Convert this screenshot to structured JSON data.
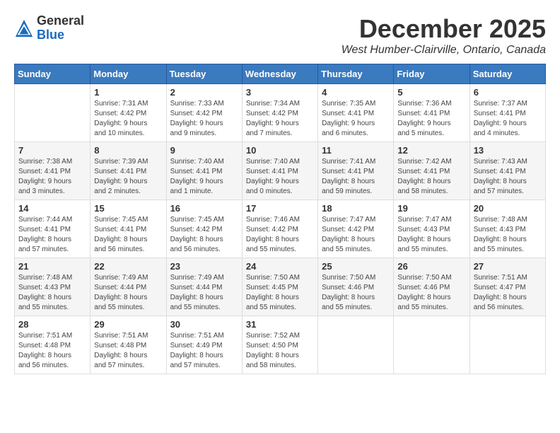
{
  "logo": {
    "general": "General",
    "blue": "Blue"
  },
  "title": "December 2025",
  "location": "West Humber-Clairville, Ontario, Canada",
  "days_of_week": [
    "Sunday",
    "Monday",
    "Tuesday",
    "Wednesday",
    "Thursday",
    "Friday",
    "Saturday"
  ],
  "weeks": [
    [
      {
        "day": "",
        "info": ""
      },
      {
        "day": "1",
        "info": "Sunrise: 7:31 AM\nSunset: 4:42 PM\nDaylight: 9 hours\nand 10 minutes."
      },
      {
        "day": "2",
        "info": "Sunrise: 7:33 AM\nSunset: 4:42 PM\nDaylight: 9 hours\nand 9 minutes."
      },
      {
        "day": "3",
        "info": "Sunrise: 7:34 AM\nSunset: 4:42 PM\nDaylight: 9 hours\nand 7 minutes."
      },
      {
        "day": "4",
        "info": "Sunrise: 7:35 AM\nSunset: 4:41 PM\nDaylight: 9 hours\nand 6 minutes."
      },
      {
        "day": "5",
        "info": "Sunrise: 7:36 AM\nSunset: 4:41 PM\nDaylight: 9 hours\nand 5 minutes."
      },
      {
        "day": "6",
        "info": "Sunrise: 7:37 AM\nSunset: 4:41 PM\nDaylight: 9 hours\nand 4 minutes."
      }
    ],
    [
      {
        "day": "7",
        "info": "Sunrise: 7:38 AM\nSunset: 4:41 PM\nDaylight: 9 hours\nand 3 minutes."
      },
      {
        "day": "8",
        "info": "Sunrise: 7:39 AM\nSunset: 4:41 PM\nDaylight: 9 hours\nand 2 minutes."
      },
      {
        "day": "9",
        "info": "Sunrise: 7:40 AM\nSunset: 4:41 PM\nDaylight: 9 hours\nand 1 minute."
      },
      {
        "day": "10",
        "info": "Sunrise: 7:40 AM\nSunset: 4:41 PM\nDaylight: 9 hours\nand 0 minutes."
      },
      {
        "day": "11",
        "info": "Sunrise: 7:41 AM\nSunset: 4:41 PM\nDaylight: 8 hours\nand 59 minutes."
      },
      {
        "day": "12",
        "info": "Sunrise: 7:42 AM\nSunset: 4:41 PM\nDaylight: 8 hours\nand 58 minutes."
      },
      {
        "day": "13",
        "info": "Sunrise: 7:43 AM\nSunset: 4:41 PM\nDaylight: 8 hours\nand 57 minutes."
      }
    ],
    [
      {
        "day": "14",
        "info": "Sunrise: 7:44 AM\nSunset: 4:41 PM\nDaylight: 8 hours\nand 57 minutes."
      },
      {
        "day": "15",
        "info": "Sunrise: 7:45 AM\nSunset: 4:41 PM\nDaylight: 8 hours\nand 56 minutes."
      },
      {
        "day": "16",
        "info": "Sunrise: 7:45 AM\nSunset: 4:42 PM\nDaylight: 8 hours\nand 56 minutes."
      },
      {
        "day": "17",
        "info": "Sunrise: 7:46 AM\nSunset: 4:42 PM\nDaylight: 8 hours\nand 55 minutes."
      },
      {
        "day": "18",
        "info": "Sunrise: 7:47 AM\nSunset: 4:42 PM\nDaylight: 8 hours\nand 55 minutes."
      },
      {
        "day": "19",
        "info": "Sunrise: 7:47 AM\nSunset: 4:43 PM\nDaylight: 8 hours\nand 55 minutes."
      },
      {
        "day": "20",
        "info": "Sunrise: 7:48 AM\nSunset: 4:43 PM\nDaylight: 8 hours\nand 55 minutes."
      }
    ],
    [
      {
        "day": "21",
        "info": "Sunrise: 7:48 AM\nSunset: 4:43 PM\nDaylight: 8 hours\nand 55 minutes."
      },
      {
        "day": "22",
        "info": "Sunrise: 7:49 AM\nSunset: 4:44 PM\nDaylight: 8 hours\nand 55 minutes."
      },
      {
        "day": "23",
        "info": "Sunrise: 7:49 AM\nSunset: 4:44 PM\nDaylight: 8 hours\nand 55 minutes."
      },
      {
        "day": "24",
        "info": "Sunrise: 7:50 AM\nSunset: 4:45 PM\nDaylight: 8 hours\nand 55 minutes."
      },
      {
        "day": "25",
        "info": "Sunrise: 7:50 AM\nSunset: 4:46 PM\nDaylight: 8 hours\nand 55 minutes."
      },
      {
        "day": "26",
        "info": "Sunrise: 7:50 AM\nSunset: 4:46 PM\nDaylight: 8 hours\nand 55 minutes."
      },
      {
        "day": "27",
        "info": "Sunrise: 7:51 AM\nSunset: 4:47 PM\nDaylight: 8 hours\nand 56 minutes."
      }
    ],
    [
      {
        "day": "28",
        "info": "Sunrise: 7:51 AM\nSunset: 4:48 PM\nDaylight: 8 hours\nand 56 minutes."
      },
      {
        "day": "29",
        "info": "Sunrise: 7:51 AM\nSunset: 4:48 PM\nDaylight: 8 hours\nand 57 minutes."
      },
      {
        "day": "30",
        "info": "Sunrise: 7:51 AM\nSunset: 4:49 PM\nDaylight: 8 hours\nand 57 minutes."
      },
      {
        "day": "31",
        "info": "Sunrise: 7:52 AM\nSunset: 4:50 PM\nDaylight: 8 hours\nand 58 minutes."
      },
      {
        "day": "",
        "info": ""
      },
      {
        "day": "",
        "info": ""
      },
      {
        "day": "",
        "info": ""
      }
    ]
  ]
}
